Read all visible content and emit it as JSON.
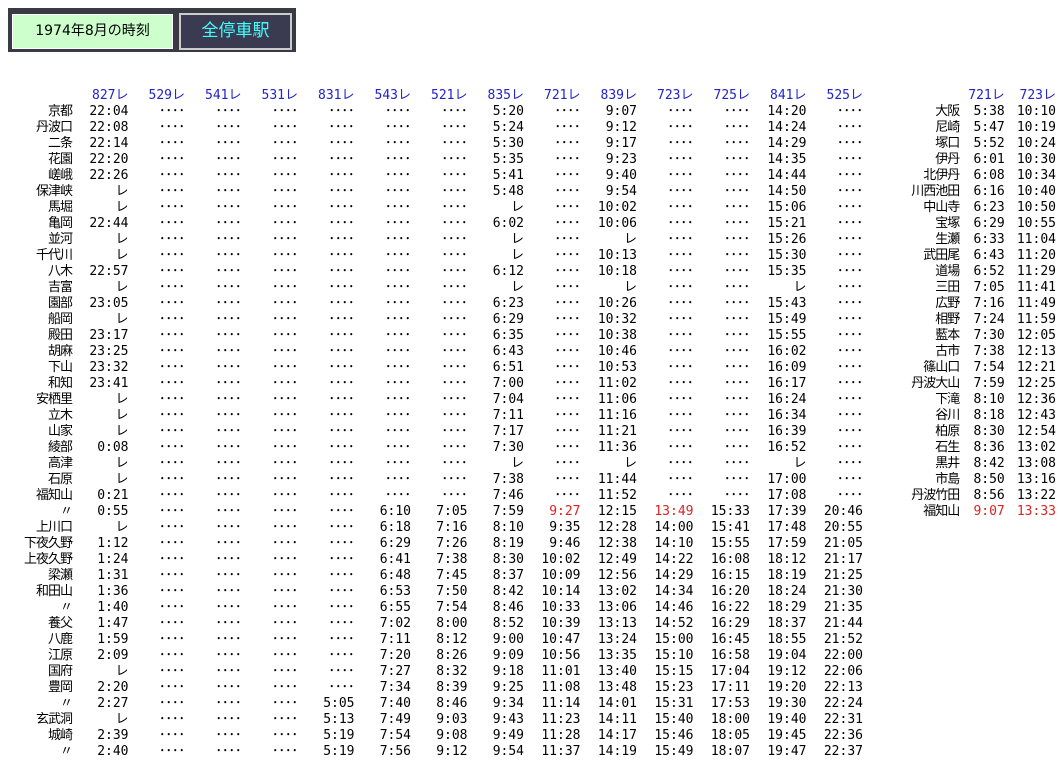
{
  "header": {
    "date_label": "1974年8月の時刻",
    "title": "全停車駅"
  },
  "colors": {
    "train_header": "#2222cc",
    "highlight": "#dd2222",
    "date_bg": "#ccffcc",
    "title_text": "#44ffff"
  },
  "left_table": {
    "trains": [
      "827レ",
      "529レ",
      "541レ",
      "531レ",
      "831レ",
      "543レ",
      "521レ",
      "835レ",
      "721レ",
      "839レ",
      "723レ",
      "725レ",
      "841レ",
      "525レ"
    ],
    "rows": [
      {
        "station": "京都",
        "times": [
          "22:04",
          "････",
          "････",
          "････",
          "････",
          "････",
          "････",
          "5:20",
          "････",
          "9:07",
          "････",
          "････",
          "14:20",
          "････"
        ]
      },
      {
        "station": "丹波口",
        "times": [
          "22:08",
          "････",
          "････",
          "････",
          "････",
          "････",
          "････",
          "5:24",
          "････",
          "9:12",
          "････",
          "････",
          "14:24",
          "････"
        ]
      },
      {
        "station": "二条",
        "times": [
          "22:14",
          "････",
          "････",
          "････",
          "････",
          "････",
          "････",
          "5:30",
          "････",
          "9:17",
          "････",
          "････",
          "14:29",
          "････"
        ]
      },
      {
        "station": "花園",
        "times": [
          "22:20",
          "････",
          "････",
          "････",
          "････",
          "････",
          "････",
          "5:35",
          "････",
          "9:23",
          "････",
          "････",
          "14:35",
          "････"
        ]
      },
      {
        "station": "嵯峨",
        "times": [
          "22:26",
          "････",
          "････",
          "････",
          "････",
          "････",
          "････",
          "5:41",
          "････",
          "9:40",
          "････",
          "････",
          "14:44",
          "････"
        ]
      },
      {
        "station": "保津峡",
        "times": [
          "レ",
          "････",
          "････",
          "････",
          "････",
          "････",
          "････",
          "5:48",
          "････",
          "9:54",
          "････",
          "････",
          "14:50",
          "････"
        ]
      },
      {
        "station": "馬堀",
        "times": [
          "レ",
          "････",
          "････",
          "････",
          "････",
          "････",
          "････",
          "レ",
          "････",
          "10:02",
          "････",
          "････",
          "15:06",
          "････"
        ]
      },
      {
        "station": "亀岡",
        "times": [
          "22:44",
          "････",
          "････",
          "････",
          "････",
          "････",
          "････",
          "6:02",
          "････",
          "10:06",
          "････",
          "････",
          "15:21",
          "････"
        ]
      },
      {
        "station": "並河",
        "times": [
          "レ",
          "････",
          "････",
          "････",
          "････",
          "････",
          "････",
          "レ",
          "････",
          "レ",
          "････",
          "････",
          "15:26",
          "････"
        ]
      },
      {
        "station": "千代川",
        "times": [
          "レ",
          "････",
          "････",
          "････",
          "････",
          "････",
          "････",
          "レ",
          "････",
          "10:13",
          "････",
          "････",
          "15:30",
          "････"
        ]
      },
      {
        "station": "八木",
        "times": [
          "22:57",
          "････",
          "････",
          "････",
          "････",
          "････",
          "････",
          "6:12",
          "････",
          "10:18",
          "････",
          "････",
          "15:35",
          "････"
        ]
      },
      {
        "station": "吉富",
        "times": [
          "レ",
          "････",
          "････",
          "････",
          "････",
          "････",
          "････",
          "レ",
          "････",
          "レ",
          "････",
          "････",
          "レ",
          "････"
        ]
      },
      {
        "station": "園部",
        "times": [
          "23:05",
          "････",
          "････",
          "････",
          "････",
          "････",
          "････",
          "6:23",
          "････",
          "10:26",
          "････",
          "････",
          "15:43",
          "････"
        ]
      },
      {
        "station": "船岡",
        "times": [
          "レ",
          "････",
          "････",
          "････",
          "････",
          "････",
          "････",
          "6:29",
          "････",
          "10:32",
          "････",
          "････",
          "15:49",
          "････"
        ]
      },
      {
        "station": "殿田",
        "times": [
          "23:17",
          "････",
          "････",
          "････",
          "････",
          "････",
          "････",
          "6:35",
          "････",
          "10:38",
          "････",
          "････",
          "15:55",
          "････"
        ]
      },
      {
        "station": "胡麻",
        "times": [
          "23:25",
          "････",
          "････",
          "････",
          "････",
          "････",
          "････",
          "6:43",
          "････",
          "10:46",
          "････",
          "････",
          "16:02",
          "････"
        ]
      },
      {
        "station": "下山",
        "times": [
          "23:32",
          "････",
          "････",
          "････",
          "････",
          "････",
          "････",
          "6:51",
          "････",
          "10:53",
          "････",
          "････",
          "16:09",
          "････"
        ]
      },
      {
        "station": "和知",
        "times": [
          "23:41",
          "････",
          "････",
          "････",
          "････",
          "････",
          "････",
          "7:00",
          "････",
          "11:02",
          "････",
          "････",
          "16:17",
          "････"
        ]
      },
      {
        "station": "安栖里",
        "times": [
          "レ",
          "････",
          "････",
          "････",
          "････",
          "････",
          "････",
          "7:04",
          "････",
          "11:06",
          "････",
          "････",
          "16:24",
          "････"
        ]
      },
      {
        "station": "立木",
        "times": [
          "レ",
          "････",
          "････",
          "････",
          "････",
          "････",
          "････",
          "7:11",
          "････",
          "11:16",
          "････",
          "････",
          "16:34",
          "････"
        ]
      },
      {
        "station": "山家",
        "times": [
          "レ",
          "････",
          "････",
          "････",
          "････",
          "････",
          "････",
          "7:17",
          "････",
          "11:21",
          "････",
          "････",
          "16:39",
          "････"
        ]
      },
      {
        "station": "綾部",
        "times": [
          "0:08",
          "････",
          "････",
          "････",
          "････",
          "････",
          "････",
          "7:30",
          "････",
          "11:36",
          "････",
          "････",
          "16:52",
          "････"
        ]
      },
      {
        "station": "高津",
        "times": [
          "レ",
          "････",
          "････",
          "････",
          "････",
          "････",
          "････",
          "レ",
          "････",
          "レ",
          "････",
          "････",
          "レ",
          "････"
        ]
      },
      {
        "station": "石原",
        "times": [
          "レ",
          "････",
          "････",
          "････",
          "････",
          "････",
          "････",
          "7:38",
          "････",
          "11:44",
          "････",
          "････",
          "17:00",
          "････"
        ]
      },
      {
        "station": "福知山",
        "times": [
          "0:21",
          "････",
          "････",
          "････",
          "････",
          "････",
          "････",
          "7:46",
          "････",
          "11:52",
          "････",
          "････",
          "17:08",
          "････"
        ]
      },
      {
        "station": "〃",
        "times": [
          "0:55",
          "････",
          "････",
          "････",
          "････",
          "6:10",
          "7:05",
          "7:59",
          "9:27",
          "12:15",
          "13:49",
          "15:33",
          "17:39",
          "20:46"
        ]
      },
      {
        "station": "上川口",
        "times": [
          "レ",
          "････",
          "････",
          "････",
          "････",
          "6:18",
          "7:16",
          "8:10",
          "9:35",
          "12:28",
          "14:00",
          "15:41",
          "17:48",
          "20:55"
        ]
      },
      {
        "station": "下夜久野",
        "times": [
          "1:12",
          "････",
          "････",
          "････",
          "････",
          "6:29",
          "7:26",
          "8:19",
          "9:46",
          "12:38",
          "14:10",
          "15:55",
          "17:59",
          "21:05"
        ]
      },
      {
        "station": "上夜久野",
        "times": [
          "1:24",
          "････",
          "････",
          "････",
          "････",
          "6:41",
          "7:38",
          "8:30",
          "10:02",
          "12:49",
          "14:22",
          "16:08",
          "18:12",
          "21:17"
        ]
      },
      {
        "station": "梁瀬",
        "times": [
          "1:31",
          "････",
          "････",
          "････",
          "････",
          "6:48",
          "7:45",
          "8:37",
          "10:09",
          "12:56",
          "14:29",
          "16:15",
          "18:19",
          "21:25"
        ]
      },
      {
        "station": "和田山",
        "times": [
          "1:36",
          "････",
          "････",
          "････",
          "････",
          "6:53",
          "7:50",
          "8:42",
          "10:14",
          "13:02",
          "14:34",
          "16:20",
          "18:24",
          "21:30"
        ]
      },
      {
        "station": "〃",
        "times": [
          "1:40",
          "････",
          "････",
          "････",
          "････",
          "6:55",
          "7:54",
          "8:46",
          "10:33",
          "13:06",
          "14:46",
          "16:22",
          "18:29",
          "21:35"
        ]
      },
      {
        "station": "養父",
        "times": [
          "1:47",
          "････",
          "････",
          "････",
          "････",
          "7:02",
          "8:00",
          "8:52",
          "10:39",
          "13:13",
          "14:52",
          "16:29",
          "18:37",
          "21:44"
        ]
      },
      {
        "station": "八鹿",
        "times": [
          "1:59",
          "････",
          "････",
          "････",
          "････",
          "7:11",
          "8:12",
          "9:00",
          "10:47",
          "13:24",
          "15:00",
          "16:45",
          "18:55",
          "21:52"
        ]
      },
      {
        "station": "江原",
        "times": [
          "2:09",
          "････",
          "････",
          "････",
          "････",
          "7:20",
          "8:26",
          "9:09",
          "10:56",
          "13:35",
          "15:10",
          "16:58",
          "19:04",
          "22:00"
        ]
      },
      {
        "station": "国府",
        "times": [
          "レ",
          "････",
          "････",
          "････",
          "････",
          "7:27",
          "8:32",
          "9:18",
          "11:01",
          "13:40",
          "15:15",
          "17:04",
          "19:12",
          "22:06"
        ]
      },
      {
        "station": "豊岡",
        "times": [
          "2:20",
          "････",
          "････",
          "････",
          "････",
          "7:34",
          "8:39",
          "9:25",
          "11:08",
          "13:48",
          "15:23",
          "17:11",
          "19:20",
          "22:13"
        ]
      },
      {
        "station": "〃",
        "times": [
          "2:27",
          "････",
          "････",
          "････",
          "5:05",
          "7:40",
          "8:46",
          "9:34",
          "11:14",
          "14:01",
          "15:31",
          "17:53",
          "19:30",
          "22:24"
        ]
      },
      {
        "station": "玄武洞",
        "times": [
          "レ",
          "････",
          "････",
          "････",
          "5:13",
          "7:49",
          "9:03",
          "9:43",
          "11:23",
          "14:11",
          "15:40",
          "18:00",
          "19:40",
          "22:31"
        ]
      },
      {
        "station": "城崎",
        "times": [
          "2:39",
          "････",
          "････",
          "････",
          "5:19",
          "7:54",
          "9:08",
          "9:49",
          "11:28",
          "14:17",
          "15:46",
          "18:05",
          "19:45",
          "22:36"
        ]
      },
      {
        "station": "〃",
        "times": [
          "2:40",
          "････",
          "････",
          "････",
          "5:19",
          "7:56",
          "9:12",
          "9:54",
          "11:37",
          "14:19",
          "15:49",
          "18:07",
          "19:47",
          "22:37"
        ]
      }
    ],
    "red_cells": [
      {
        "row": 25,
        "col": 8
      },
      {
        "row": 25,
        "col": 10
      }
    ]
  },
  "right_table": {
    "trains": [
      "721レ",
      "723レ"
    ],
    "rows": [
      {
        "station": "大阪",
        "times": [
          "5:38",
          "10:10"
        ]
      },
      {
        "station": "尼崎",
        "times": [
          "5:47",
          "10:19"
        ]
      },
      {
        "station": "塚口",
        "times": [
          "5:52",
          "10:24"
        ]
      },
      {
        "station": "伊丹",
        "times": [
          "6:01",
          "10:30"
        ]
      },
      {
        "station": "北伊丹",
        "times": [
          "6:08",
          "10:34"
        ]
      },
      {
        "station": "川西池田",
        "times": [
          "6:16",
          "10:40"
        ]
      },
      {
        "station": "中山寺",
        "times": [
          "6:23",
          "10:50"
        ]
      },
      {
        "station": "宝塚",
        "times": [
          "6:29",
          "10:55"
        ]
      },
      {
        "station": "生瀬",
        "times": [
          "6:33",
          "11:04"
        ]
      },
      {
        "station": "武田尾",
        "times": [
          "6:43",
          "11:20"
        ]
      },
      {
        "station": "道場",
        "times": [
          "6:52",
          "11:29"
        ]
      },
      {
        "station": "三田",
        "times": [
          "7:05",
          "11:41"
        ]
      },
      {
        "station": "広野",
        "times": [
          "7:16",
          "11:49"
        ]
      },
      {
        "station": "相野",
        "times": [
          "7:24",
          "11:59"
        ]
      },
      {
        "station": "藍本",
        "times": [
          "7:30",
          "12:05"
        ]
      },
      {
        "station": "古市",
        "times": [
          "7:38",
          "12:13"
        ]
      },
      {
        "station": "篠山口",
        "times": [
          "7:54",
          "12:21"
        ]
      },
      {
        "station": "丹波大山",
        "times": [
          "7:59",
          "12:25"
        ]
      },
      {
        "station": "下滝",
        "times": [
          "8:10",
          "12:36"
        ]
      },
      {
        "station": "谷川",
        "times": [
          "8:18",
          "12:43"
        ]
      },
      {
        "station": "柏原",
        "times": [
          "8:30",
          "12:54"
        ]
      },
      {
        "station": "石生",
        "times": [
          "8:36",
          "13:02"
        ]
      },
      {
        "station": "黒井",
        "times": [
          "8:42",
          "13:08"
        ]
      },
      {
        "station": "市島",
        "times": [
          "8:50",
          "13:16"
        ]
      },
      {
        "station": "丹波竹田",
        "times": [
          "8:56",
          "13:22"
        ]
      },
      {
        "station": "福知山",
        "times": [
          "9:07",
          "13:33"
        ]
      }
    ],
    "red_cells": [
      {
        "row": 25,
        "col": 0
      },
      {
        "row": 25,
        "col": 1
      }
    ]
  }
}
